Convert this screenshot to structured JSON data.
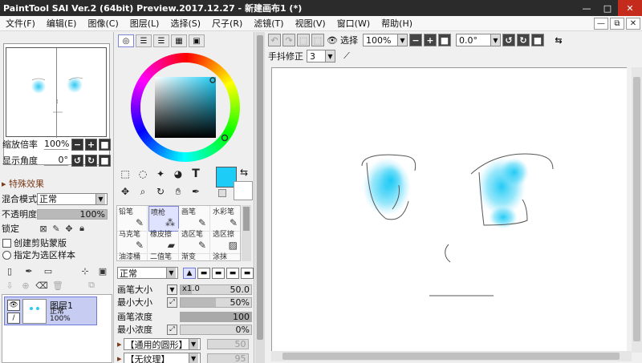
{
  "titlebar": {
    "title": "PaintTool SAI Ver.2 (64bit) Preview.2017.12.27 - 新建画布1 (*)",
    "minimize": "—",
    "maximize": "□",
    "close": "✕"
  },
  "menu": [
    "文件(F)",
    "编辑(E)",
    "图像(C)",
    "图层(L)",
    "选择(S)",
    "尺子(R)",
    "滤镜(T)",
    "视图(V)",
    "窗口(W)",
    "帮助(H)"
  ],
  "mdi": [
    "—",
    "⧉",
    "✕"
  ],
  "navigator": {
    "zoom_label": "缩放倍率",
    "zoom_value": "100%",
    "angle_label": "显示角度",
    "angle_value": "0°"
  },
  "layer_panel": {
    "effects_label": "特殊效果",
    "blend_label": "混合模式",
    "blend_value": "正常",
    "opacity_label": "不透明度",
    "opacity_value": "100%",
    "lock_label": "锁定",
    "clip_label": "创建剪贴蒙版",
    "selsrc_label": "指定为选区样本",
    "layer": {
      "name": "图层1",
      "mode": "正常",
      "opacity": "100%"
    }
  },
  "color_panel": {
    "primary_color": "#1ecdf7",
    "secondary_color": "#ffffff"
  },
  "brushes": [
    {
      "name": "铅笔",
      "icon": "pencil-icon"
    },
    {
      "name": "喷枪",
      "icon": "airbrush-icon",
      "selected": true
    },
    {
      "name": "画笔",
      "icon": "brush-icon"
    },
    {
      "name": "水彩笔",
      "icon": "watercolor-icon"
    },
    {
      "name": "马克笔",
      "icon": "marker-icon"
    },
    {
      "name": "橡皮擦",
      "icon": "eraser-icon"
    },
    {
      "name": "选区笔",
      "icon": "select-pen-icon"
    },
    {
      "name": "选区擦",
      "icon": "select-erase-icon"
    },
    {
      "name": "油漆桶",
      "icon": "bucket-icon"
    },
    {
      "name": "二值笔",
      "icon": "binary-pen-icon"
    },
    {
      "name": "渐变",
      "icon": "gradient-icon"
    },
    {
      "name": "涂抹",
      "icon": "smudge-icon"
    }
  ],
  "brush_props": {
    "mode": "正常",
    "size_label": "画笔大小",
    "size_mult": "x1.0",
    "size_value": "50.0",
    "min_size_label": "最小大小",
    "min_size_value": "50%",
    "min_size_fraction": 0.5,
    "density_label": "画笔浓度",
    "density_value": "100",
    "density_fraction": 1.0,
    "min_density_label": "最小浓度",
    "min_density_value": "0%",
    "min_density_fraction": 0.0,
    "shape_label": "【通用的圆形】",
    "shape_value": "50",
    "texture_label": "【无纹理】",
    "texture_value": "95"
  },
  "canvas_toolbar": {
    "select_label": "选择",
    "zoom_value": "100%",
    "angle_value": "0.0°",
    "stabilizer_label": "手抖修正",
    "stabilizer_value": "3"
  }
}
